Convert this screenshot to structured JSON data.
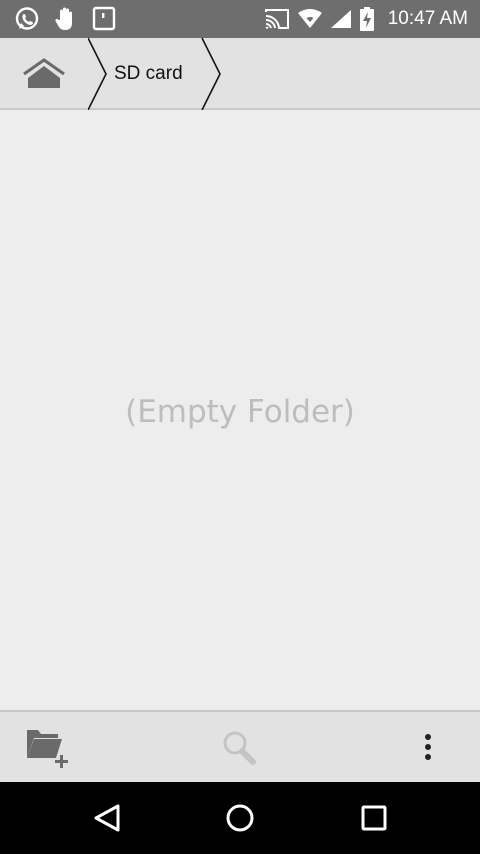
{
  "status_bar": {
    "time": "10:47 AM",
    "left_icons": [
      "whatsapp-icon",
      "hand-icon",
      "sdcard-notification-icon"
    ],
    "right_icons": [
      "cast-icon",
      "wifi-icon",
      "signal-icon",
      "battery-charging-icon"
    ]
  },
  "breadcrumb": {
    "home_icon": "home-icon",
    "items": [
      {
        "label": "SD card"
      }
    ]
  },
  "content": {
    "empty_message": "(Empty Folder)"
  },
  "toolbar": {
    "buttons": [
      "new-folder-icon",
      "search-icon",
      "more-vert-icon"
    ]
  },
  "navbar": {
    "buttons": [
      "back-icon",
      "home-circle-icon",
      "recents-icon"
    ]
  },
  "colors": {
    "status_bar_bg": "#6e6e6e",
    "bar_bg": "#e2e2e2",
    "content_bg": "#ededed",
    "empty_text": "#bdbdbd",
    "nav_bg": "#000000"
  }
}
